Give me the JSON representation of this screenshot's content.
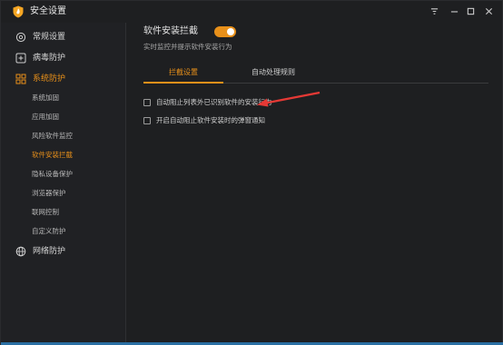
{
  "app": {
    "title": "安全设置"
  },
  "sidebar": {
    "top_items": [
      {
        "label": "常规设置",
        "icon": "gear-icon"
      },
      {
        "label": "病毒防护",
        "icon": "plus-square-icon"
      },
      {
        "label": "系统防护",
        "icon": "grid-icon",
        "active": true
      }
    ],
    "sub_items": [
      {
        "label": "系统加固"
      },
      {
        "label": "应用加固"
      },
      {
        "label": "风险软件监控"
      },
      {
        "label": "软件安装拦截",
        "active": true
      },
      {
        "label": "隐私设备保护"
      },
      {
        "label": "浏览器保护"
      },
      {
        "label": "联网控制"
      },
      {
        "label": "自定义防护"
      }
    ],
    "bottom_item": {
      "label": "网络防护",
      "icon": "globe-icon"
    }
  },
  "main": {
    "section_title": "软件安装拦截",
    "toggle_on": true,
    "section_desc": "实时监控并提示软件安装行为",
    "tabs": [
      {
        "label": "拦截设置",
        "active": true
      },
      {
        "label": "自动处理规则"
      }
    ],
    "options": [
      {
        "label": "自动阻止列表外已识别软件的安装行为",
        "checked": false
      },
      {
        "label": "开启自动阻止软件安装时的弹窗通知",
        "checked": false
      }
    ]
  },
  "colors": {
    "accent": "#e8901a",
    "background": "#1e1f21",
    "sidebar": "#202124",
    "annotation_arrow": "#e53935"
  }
}
